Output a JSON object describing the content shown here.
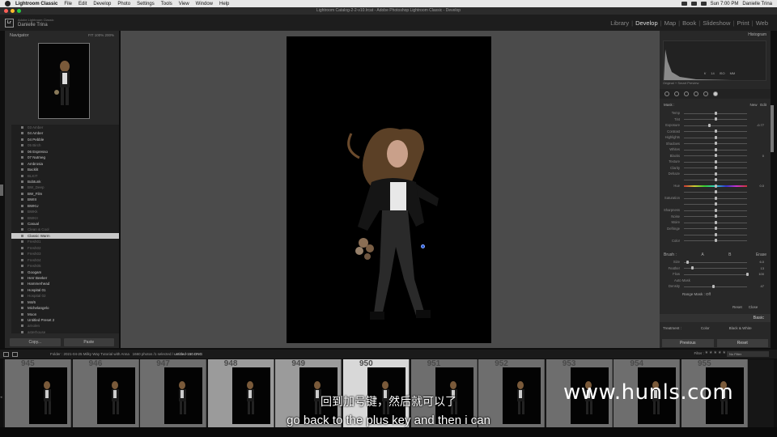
{
  "menubar": {
    "app_name": "Lightroom Classic",
    "items": [
      "File",
      "Edit",
      "Develop",
      "Photo",
      "Settings",
      "Tools",
      "View",
      "Window",
      "Help"
    ],
    "time": "Sun 7:00 PM",
    "user": "Danielle Trina"
  },
  "window": {
    "title": "Lightroom Catalog-2-2-v10.lrcat - Adobe Photoshop Lightroom Classic - Develop"
  },
  "identity": {
    "brand": "Adobe Lightroom Classic",
    "name": "Danielle Trina",
    "logo": "Lr"
  },
  "modules": {
    "items": [
      "Library",
      "Develop",
      "Map",
      "Book",
      "Slideshow",
      "Print",
      "Web"
    ],
    "active": "Develop"
  },
  "navigator": {
    "title": "Navigator",
    "options": "FIT  100%  200%"
  },
  "presets": {
    "items": [
      {
        "label": "03 Amber",
        "dim": true
      },
      {
        "label": "04 Amber",
        "dim": false
      },
      {
        "label": "04 Pebble",
        "dim": false
      },
      {
        "label": "05 Birch",
        "dim": true
      },
      {
        "label": "06 Espresso",
        "dim": false
      },
      {
        "label": "07 Nutmeg",
        "dim": false
      },
      {
        "label": "Ambrosia",
        "dim": false
      },
      {
        "label": "Backlit",
        "dim": false
      },
      {
        "label": "BLKIT",
        "dim": true
      },
      {
        "label": "Bobtunk",
        "dim": false
      },
      {
        "label": "BW_Deep",
        "dim": true
      },
      {
        "label": "BW_Film",
        "dim": false
      },
      {
        "label": "BWIII",
        "dim": false
      },
      {
        "label": "BWKU",
        "dim": false
      },
      {
        "label": "BWKk",
        "dim": true
      },
      {
        "label": "BWKII",
        "dim": true
      },
      {
        "label": "Casual",
        "dim": false
      },
      {
        "label": "Clean & Cool",
        "dim": true
      },
      {
        "label": "Classic Warm",
        "dim": false,
        "selected": true
      },
      {
        "label": "Fresh01",
        "dim": true
      },
      {
        "label": "Fresh02",
        "dim": true
      },
      {
        "label": "Fresh03",
        "dim": true
      },
      {
        "label": "Fresh04",
        "dim": true
      },
      {
        "label": "Fresh05",
        "dim": true
      },
      {
        "label": "Googam",
        "dim": false
      },
      {
        "label": "Herr Beeker",
        "dim": false
      },
      {
        "label": "Hammerhead",
        "dim": false
      },
      {
        "label": "Hospital 01",
        "dim": false
      },
      {
        "label": "Hospital 02",
        "dim": true
      },
      {
        "label": "M4/6",
        "dim": false
      },
      {
        "label": "Michelangelo",
        "dim": false
      },
      {
        "label": "Moon",
        "dim": false
      },
      {
        "label": "Untitled Preset 2",
        "dim": false
      },
      {
        "label": "arnolen",
        "dim": true
      },
      {
        "label": "asterhouse",
        "dim": true
      }
    ]
  },
  "left_buttons": {
    "copy": "Copy...",
    "paste": "Paste"
  },
  "histogram": {
    "title": "Histogram",
    "values": [
      "f/",
      "14",
      "0",
      "ISO",
      "5",
      "MM",
      "/s"
    ],
    "original_preview": "Original + Smart Preview"
  },
  "mask": {
    "label": "Mask :",
    "new": "New",
    "edit": "Edit",
    "effect": "Effect :",
    "preset": "Custom"
  },
  "sliders": [
    {
      "label": "Temp",
      "value": "",
      "pos": 0.5
    },
    {
      "label": "Tint",
      "value": "",
      "pos": 0.5
    },
    {
      "label": "Exposure",
      "value": "-0.77",
      "pos": 0.4
    },
    {
      "label": "Contrast",
      "value": "",
      "pos": 0.5
    },
    {
      "label": "Highlights",
      "value": "",
      "pos": 0.5
    },
    {
      "label": "Shadows",
      "value": "",
      "pos": 0.5
    },
    {
      "label": "Whites",
      "value": "",
      "pos": 0.5
    },
    {
      "label": "Blacks",
      "value": "0",
      "pos": 0.5
    },
    {
      "label": "Texture",
      "value": "",
      "pos": 0.5
    },
    {
      "label": "Clarity",
      "value": "",
      "pos": 0.5
    },
    {
      "label": "Dehaze",
      "value": "",
      "pos": 0.5
    },
    {
      "label": "",
      "value": "",
      "pos": 0.5
    },
    {
      "label": "Hue",
      "value": "0.0",
      "pos": 0.5,
      "hue": true
    },
    {
      "label": "",
      "value": "",
      "pos": 0.5
    },
    {
      "label": "Saturation",
      "value": "",
      "pos": 0.5
    },
    {
      "label": "",
      "value": "",
      "pos": 0.5
    },
    {
      "label": "Sharpness",
      "value": "",
      "pos": 0.5
    },
    {
      "label": "Noise",
      "value": "",
      "pos": 0.5
    },
    {
      "label": "Moire",
      "value": "",
      "pos": 0.5
    },
    {
      "label": "Defringe",
      "value": "",
      "pos": 0.5
    },
    {
      "label": "",
      "value": "",
      "pos": 0.5
    },
    {
      "label": "Color",
      "value": "",
      "pos": 0.5
    }
  ],
  "brush": {
    "label": "Brush :",
    "a": "A",
    "b": "B",
    "erase": "Erase",
    "rows": [
      {
        "label": "Size",
        "value": "6.0",
        "pos": 0.06
      },
      {
        "label": "Feather",
        "value": "13",
        "pos": 0.13
      },
      {
        "label": "Flow",
        "value": "100",
        "pos": 1.0
      },
      {
        "label": "Density",
        "value": "47",
        "pos": 0.47
      }
    ],
    "auto_mask": "Auto Mask",
    "range_mask": "Range Mask :",
    "range_mask_value": "Off",
    "reset": "Reset",
    "close": "Close"
  },
  "basic": {
    "title": "Basic",
    "treatment": "Treatment :",
    "color": "Color",
    "bw": "Black & White"
  },
  "right_buttons": {
    "previous": "Previous",
    "reset": "Reset"
  },
  "filmstrip_bar": {
    "folder": "Folder : 2021-04-25 Milky Way Tutorial with Anna",
    "count": "1660 photos /1 selected /",
    "file": "untitled-150.DNG",
    "filter_label": "Filter :",
    "filter_value": "No Filter"
  },
  "filmstrip": {
    "numbers": [
      "945",
      "946",
      "947",
      "948",
      "949",
      "950",
      "951",
      "952",
      "953",
      "954",
      "955"
    ],
    "current_index": 5,
    "selected_indices": [
      3,
      4
    ]
  },
  "subtitles": {
    "cn": "回到加号键，然后就可以了",
    "en": "go back to the plus key and then i can"
  },
  "watermark": "www.hunls.com",
  "colors": {
    "accent_blue": "#2a5bd8",
    "panel_bg": "#282828",
    "canvas_bg": "#4b4b4b"
  }
}
